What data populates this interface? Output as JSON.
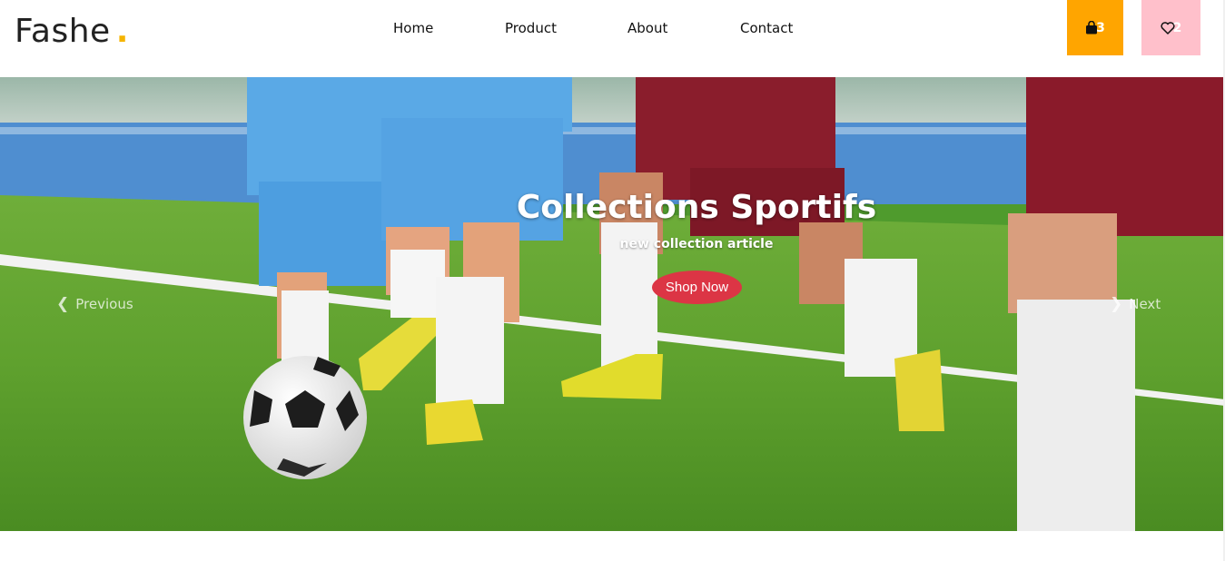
{
  "brand": {
    "name": "Fashe",
    "dot": ".",
    "dot_color": "#f5b400"
  },
  "nav": {
    "items": [
      {
        "label": "Home"
      },
      {
        "label": "Product"
      },
      {
        "label": "About"
      },
      {
        "label": "Contact"
      }
    ]
  },
  "header_actions": {
    "cart": {
      "icon": "shopping-bag-icon",
      "count": "3",
      "color": "#ffa500"
    },
    "wishlist": {
      "icon": "heart-icon",
      "count": "2",
      "color": "#ffc0cb"
    }
  },
  "hero": {
    "title": "Collections Sportifs",
    "subtitle": "new collection article",
    "cta_label": "Shop Now",
    "cta_color": "#dc3545",
    "prev_label": "Previous",
    "next_label": "Next",
    "image": "soccer-players-kicking-ball-on-grass-field"
  }
}
